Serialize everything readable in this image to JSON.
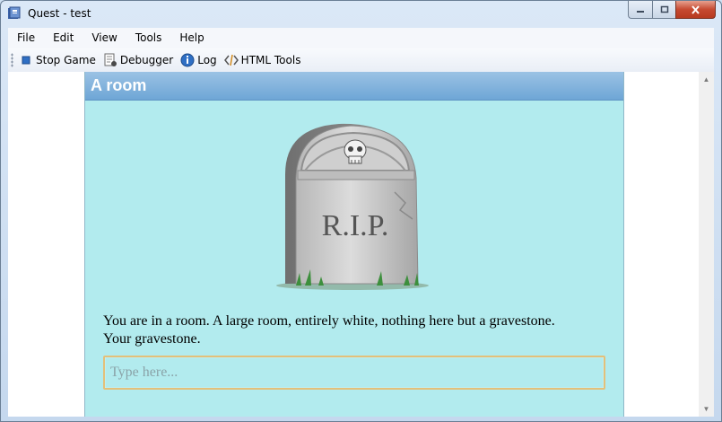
{
  "window": {
    "title": "Quest - test"
  },
  "menubar": {
    "items": [
      "File",
      "Edit",
      "View",
      "Tools",
      "Help"
    ]
  },
  "toolbar": {
    "stop_game": "Stop Game",
    "debugger": "Debugger",
    "log": "Log",
    "html_tools": "HTML Tools"
  },
  "room": {
    "title": "A room",
    "gravestone_text": "R.I.P.",
    "description_line1": "You are in a room. A large room, entirely white, nothing here but a gravestone.",
    "description_line2": "Your gravestone."
  },
  "command_input": {
    "placeholder": "Type here...",
    "value": ""
  },
  "colors": {
    "panel_bg": "#b2ebee",
    "header_bg": "#6ea6d6",
    "input_border": "#e3c07a"
  }
}
